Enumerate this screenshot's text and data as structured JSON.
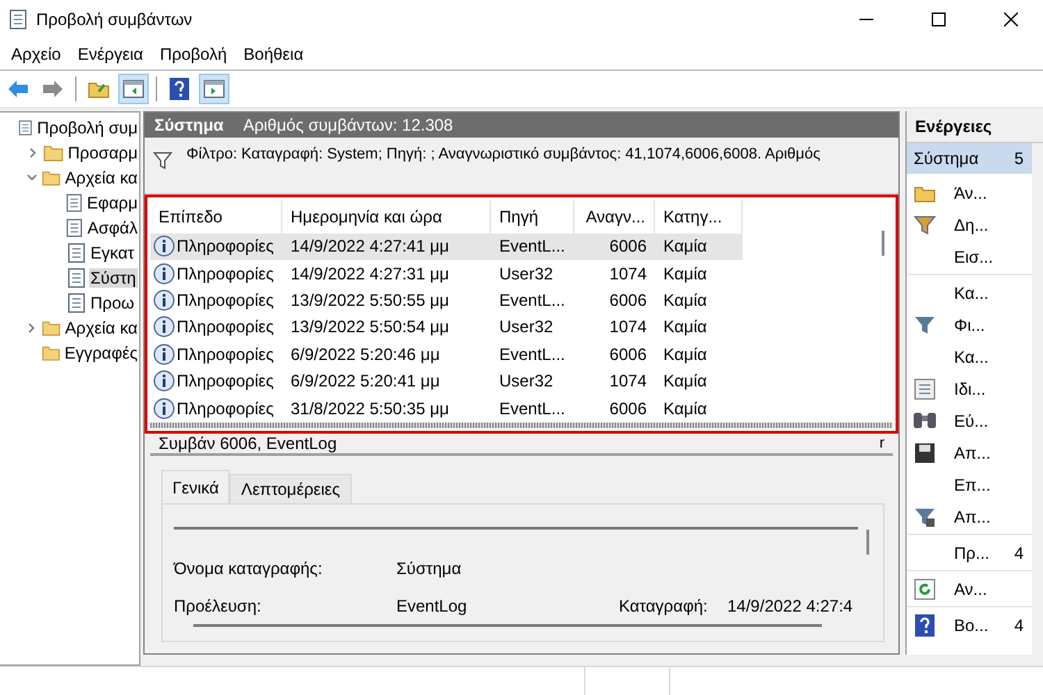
{
  "window": {
    "title": "Προβολή συμβάντων"
  },
  "menu": [
    "Αρχείο",
    "Ενέργεια",
    "Προβολή",
    "Βοήθεια"
  ],
  "toolbar": [
    {
      "pressed": false
    },
    {
      "pressed": false
    },
    {
      "pressed": false
    },
    {
      "pressed": true
    },
    {
      "pressed": false
    },
    {
      "pressed": true
    }
  ],
  "tree": [
    {
      "label": "Προβολή συμ",
      "kind": "root",
      "selected": false,
      "children": [
        {
          "label": "Προσαρμ",
          "kind": "folder",
          "expanded": false,
          "selected": false
        },
        {
          "label": "Αρχεία κα",
          "kind": "folder",
          "expanded": true,
          "selected": false,
          "children": [
            {
              "label": "Εφαρμ",
              "kind": "log",
              "selected": false
            },
            {
              "label": "Ασφάλ",
              "kind": "log",
              "selected": false
            },
            {
              "label": "Εγκατ",
              "kind": "log",
              "selected": false
            },
            {
              "label": "Σύστη",
              "kind": "log",
              "selected": true
            },
            {
              "label": "Προω",
              "kind": "log",
              "selected": false
            }
          ]
        },
        {
          "label": "Αρχεία κα",
          "kind": "folder",
          "expanded": false,
          "selected": false
        },
        {
          "label": "Εγγραφές",
          "kind": "folder",
          "selected": false
        }
      ]
    }
  ],
  "log_header": {
    "name": "Σύστημα",
    "count": "Αριθμός συμβάντων: 12.308"
  },
  "filter": "Φίλτρο: Καταγραφή: System; Πηγή: ; Αναγνωριστικό συμβάντος: 41,1074,6006,6008. Αριθμός",
  "table": {
    "columns": [
      "Επίπεδο",
      "Ημερομηνία και ώρα",
      "Πηγή",
      "Αναγν...",
      "Κατηγ..."
    ],
    "rows": [
      {
        "level": "Πληροφορίες",
        "date": "14/9/2022 4:27:41 μμ",
        "source": "EventL...",
        "id": "6006",
        "category": "Καμία",
        "selected": true
      },
      {
        "level": "Πληροφορίες",
        "date": "14/9/2022 4:27:31 μμ",
        "source": "User32",
        "id": "1074",
        "category": "Καμία",
        "selected": false
      },
      {
        "level": "Πληροφορίες",
        "date": "13/9/2022 5:50:55 μμ",
        "source": "EventL...",
        "id": "6006",
        "category": "Καμία",
        "selected": false
      },
      {
        "level": "Πληροφορίες",
        "date": "13/9/2022 5:50:54 μμ",
        "source": "User32",
        "id": "1074",
        "category": "Καμία",
        "selected": false
      },
      {
        "level": "Πληροφορίες",
        "date": "6/9/2022 5:20:46 μμ",
        "source": "EventL...",
        "id": "6006",
        "category": "Καμία",
        "selected": false
      },
      {
        "level": "Πληροφορίες",
        "date": "6/9/2022 5:20:41 μμ",
        "source": "User32",
        "id": "1074",
        "category": "Καμία",
        "selected": false
      },
      {
        "level": "Πληροφορίες",
        "date": "31/8/2022 5:50:35 μμ",
        "source": "EventL...",
        "id": "6006",
        "category": "Καμία",
        "selected": false
      }
    ]
  },
  "detail": {
    "title": "Συμβάν 6006, EventLog",
    "corner": "r",
    "tabs": [
      {
        "label": "Γενικά",
        "selected": true
      },
      {
        "label": "Λεπτομέρειες",
        "selected": false
      }
    ],
    "fields": [
      {
        "label": "Όνομα καταγραφής:",
        "value": "Σύστημα"
      },
      {
        "label": "Προέλευση:",
        "value": "EventLog",
        "extra_label": "Καταγραφή:",
        "extra_value": "14/9/2022 4:27:4"
      }
    ]
  },
  "actions": {
    "title": "Ενέργειες",
    "section": {
      "label": "Σύστημα",
      "arrow": "5"
    },
    "items": [
      {
        "kind": "action",
        "label": "Άν..."
      },
      {
        "kind": "action",
        "label": "Δη..."
      },
      {
        "kind": "action",
        "label": "Εισ..."
      },
      {
        "kind": "separator"
      },
      {
        "kind": "action",
        "label": "Κα..."
      },
      {
        "kind": "action",
        "label": "Φι..."
      },
      {
        "kind": "action",
        "label": "Κα..."
      },
      {
        "kind": "action",
        "label": "Ιδι..."
      },
      {
        "kind": "action",
        "label": "Εύ..."
      },
      {
        "kind": "action",
        "label": "Απ..."
      },
      {
        "kind": "action",
        "label": "Επ..."
      },
      {
        "kind": "action",
        "label": "Απ..."
      },
      {
        "kind": "separator"
      },
      {
        "kind": "action",
        "label": "Πρ...",
        "arrow": "4"
      },
      {
        "kind": "separator"
      },
      {
        "kind": "action",
        "label": "Αν..."
      },
      {
        "kind": "separator"
      },
      {
        "kind": "action",
        "label": "Βο...",
        "arrow": "4"
      }
    ]
  }
}
